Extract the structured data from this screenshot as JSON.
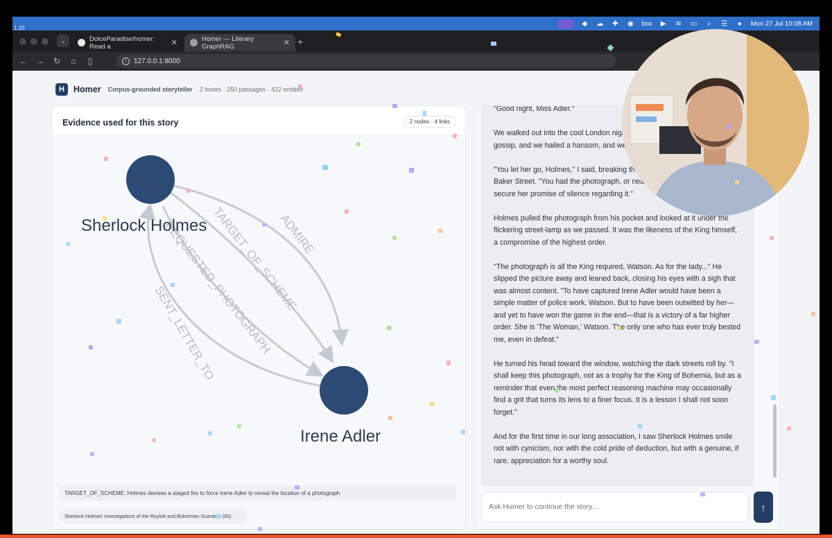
{
  "system": {
    "version_label": "1.20",
    "clock": "Mon 27 Jul  10:08 AM",
    "menubar_icons": [
      "screen-share-icon",
      "dropbox-icon",
      "cloud-icon",
      "slack-icon",
      "camera-icon",
      "box-icon",
      "play-icon",
      "wifi-icon",
      "battery-icon",
      "search-icon",
      "control-center-icon",
      "siri-icon"
    ],
    "box_label": "box"
  },
  "browser": {
    "tabs": [
      {
        "label": "DolceParadise/homer: Read a",
        "icon": "github-icon"
      },
      {
        "label": "Homer — Literary GraphRAG",
        "icon": "globe-icon"
      }
    ],
    "new_tab": "+",
    "url": "127.0.0.1:8000"
  },
  "app": {
    "logo_letter": "H",
    "name": "Homer",
    "tagline": "Corpus-grounded storyteller",
    "stats": "2 books · 250 passages · 422 entities"
  },
  "evidence": {
    "title": "Evidence used for this story",
    "badge": "2 nodes · 4 links",
    "nodes": [
      {
        "id": "holmes",
        "label": "Sherlock Holmes"
      },
      {
        "id": "adler",
        "label": "Irene Adler"
      }
    ],
    "edges": [
      {
        "label": "ADMIRE"
      },
      {
        "label": "TARGET_OF_SCHEME"
      },
      {
        "label": "REQUESTED_PHOTOGRAPH"
      },
      {
        "label": "SENT_LETTER_TO"
      }
    ],
    "node_color": "#2c4a73",
    "edge_color": "#c5cad3",
    "rows": [
      "TARGET_OF_SCHEME: Holmes devises a staged fire to force Irene Adler to reveal the location of a photograph",
      "Sherlock Holmes' Investigations of the Roylott and Bohemian Scandals (65)"
    ]
  },
  "story": {
    "paragraphs": [
      "\"Good night, Miss Adler.\"",
      "We walked out into the cool London night, the drama of the fire faded into gossip, and we hailed a hansom, and we sank back onto the worn seats.",
      "\"You let her go, Holmes,\" I said, breaking the silence as we rattled toward Baker Street. \"You had the photograph, or near enough. You did not even secure her promise of silence regarding it.\"",
      "Holmes pulled the photograph from his pocket and looked at it under the flickering street-lamp as we passed. It was the likeness of the King himself, a compromise of the highest order.",
      "\"The photograph is all the King required, Watson. As for the lady...\" He slipped the picture away and leaned back, closing his eyes with a sigh that was almost content. \"To have captured Irene Adler would have been a simple matter of police work, Watson. But to have been outwitted by her—and yet to have won the game in the end—that is a victory of a far higher order. She is 'The Woman,' Watson. The only one who has ever truly bested me, even in defeat.\"",
      "He turned his head toward the window, watching the dark streets roll by. \"I shall keep this photograph, not as a trophy for the King of Bohemia, but as a reminder that even the most perfect reasoning machine may occasionally find a grit that turns its lens to a finer focus. It is a lesson I shall not soon forget.\"",
      "And for the first time in our long association, I saw Sherlock Holmes smile not with cynicism, nor with the cold pride of deduction, but with a genuine, if rare, appreciation for a worthy soul."
    ],
    "input_placeholder": "Ask Homer to continue the story...",
    "send_icon": "↑",
    "accent": "#243e63"
  }
}
